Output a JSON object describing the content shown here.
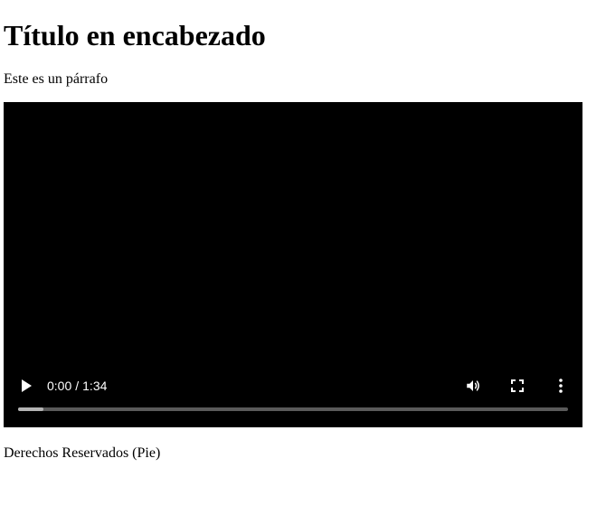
{
  "header": {
    "title": "Título en encabezado"
  },
  "main": {
    "paragraph": "Este es un párrafo"
  },
  "video": {
    "current_time": "0:00",
    "separator": "/",
    "duration": "1:34",
    "buffered_fraction": 0.046,
    "icons": {
      "play": "play-icon",
      "volume": "volume-icon",
      "fullscreen": "fullscreen-icon",
      "menu": "more-vert-icon"
    },
    "colors": {
      "background": "#000000",
      "controls": "#ffffff",
      "track": "#5a5a5a",
      "buffer": "#b4b4b4"
    }
  },
  "footer": {
    "text": "Derechos Reservados (Pie)"
  }
}
